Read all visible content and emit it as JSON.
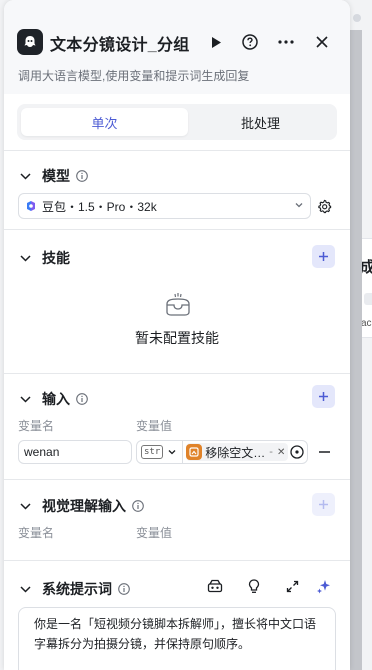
{
  "header": {
    "title": "文本分镜设计_分组",
    "description": "调用大语言模型,使用变量和提示词生成回复"
  },
  "mode_tabs": [
    "单次",
    "批处理"
  ],
  "sections": {
    "model": {
      "title": "模型",
      "selected": "豆包・1.5・Pro・32k"
    },
    "skills": {
      "title": "技能",
      "empty_text": "暂未配置技能"
    },
    "input": {
      "title": "输入",
      "col_name": "变量名",
      "col_value": "变量值",
      "row": {
        "name": "wenan",
        "type": "str",
        "ref_label": "移除空文…",
        "ref_more": "-"
      }
    },
    "visual_input": {
      "title": "视觉理解输入",
      "col_name": "变量名",
      "col_value": "变量值"
    },
    "system_prompt": {
      "title": "系统提示词",
      "content": "你是一名「短视频分镜脚本拆解师」，擅长将中文口语字幕拆分为拍摄分镜，并保持原句顺序。"
    }
  },
  "background": {
    "node_title": "成",
    "node_text": "ac",
    "node_chip": "s"
  },
  "colors": {
    "accent": "#4c5bd4",
    "accent_bg": "#e4e7fb",
    "ref_icon": "#e0832a"
  }
}
